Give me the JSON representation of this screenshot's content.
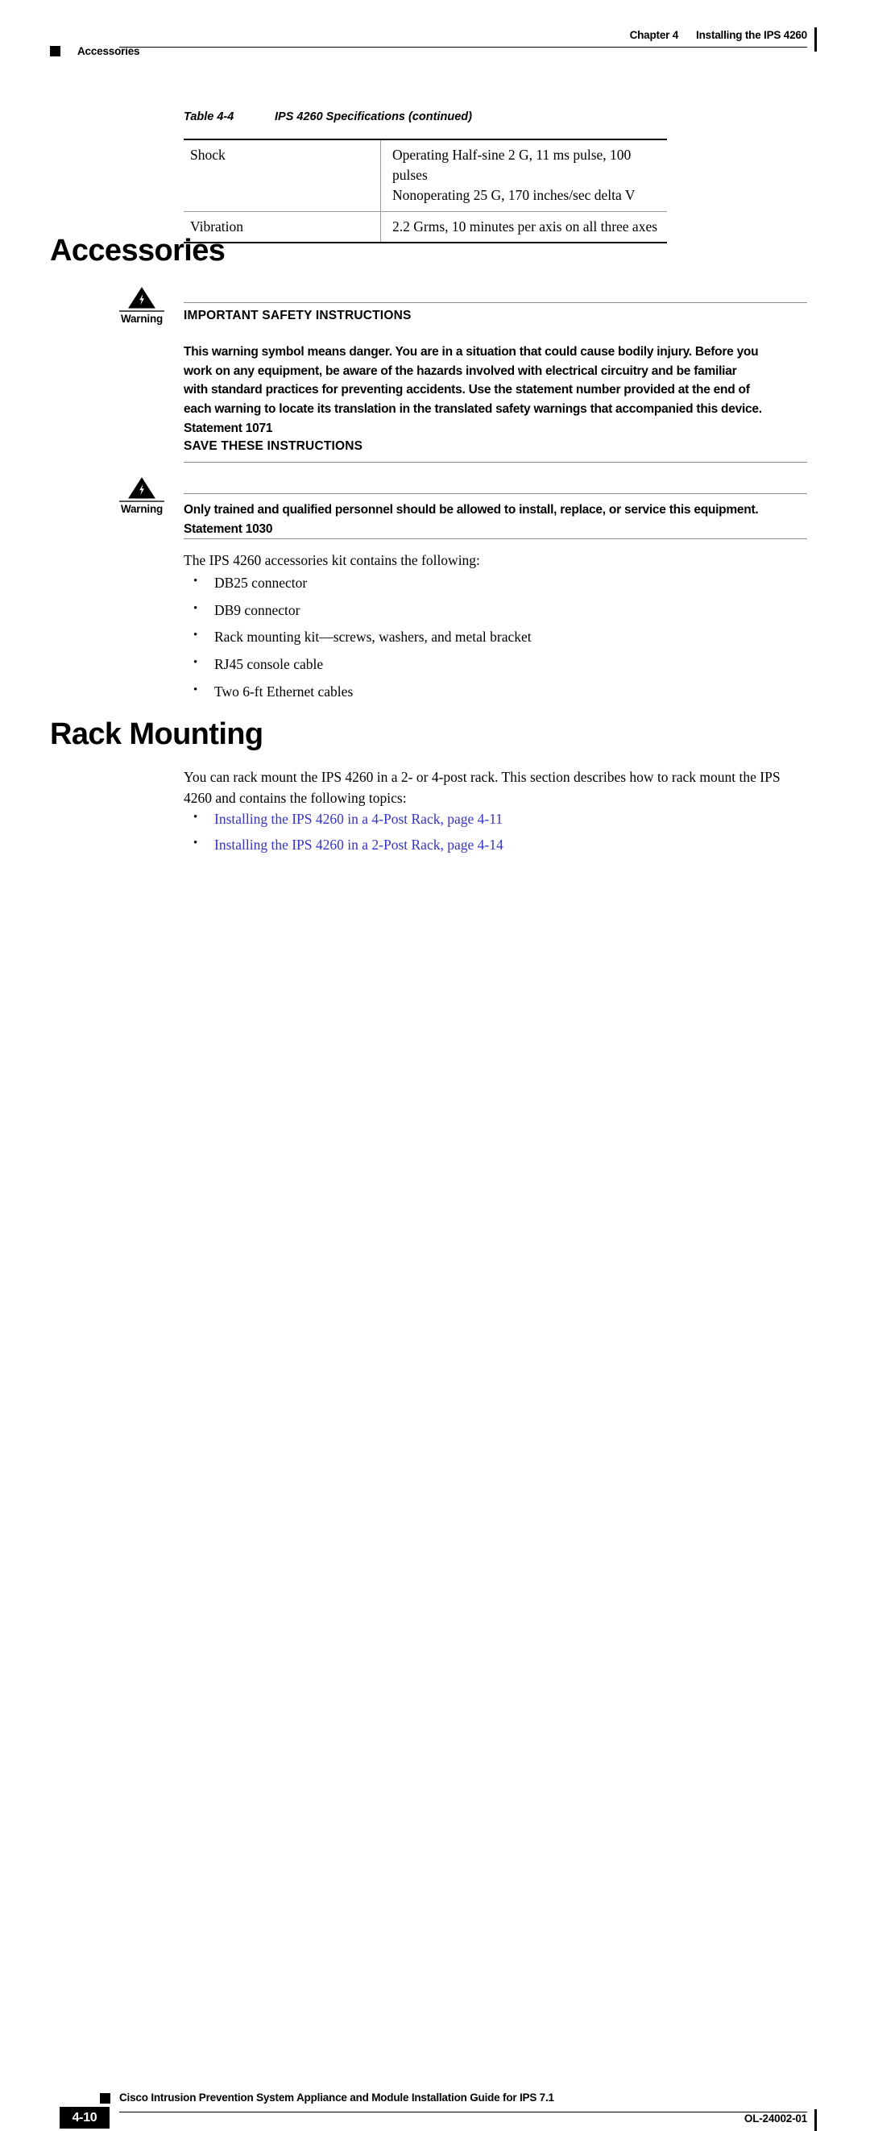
{
  "header": {
    "chapter_number": "Chapter 4",
    "chapter_title": "Installing the IPS 4260",
    "running_section": "Accessories"
  },
  "table": {
    "caption_number": "Table 4-4",
    "caption_title": "IPS 4260 Specifications (continued)",
    "rows": [
      {
        "key": "Shock",
        "values": [
          "Operating Half-sine 2 G, 11 ms pulse, 100 pulses",
          "Nonoperating 25 G, 170 inches/sec delta V"
        ]
      },
      {
        "key": "Vibration",
        "values": [
          "2.2 Grms, 10 minutes per axis on all three axes"
        ]
      }
    ]
  },
  "sections": {
    "accessories": {
      "title": "Accessories",
      "intro": "The IPS 4260 accessories kit contains the following:",
      "items": [
        "DB25 connector",
        "DB9 connector",
        "Rack mounting kit—screws, washers, and metal bracket",
        "RJ45 console cable",
        "Two 6-ft Ethernet cables"
      ]
    },
    "rack_mounting": {
      "title": "Rack Mounting",
      "intro": "You can rack mount the IPS 4260 in a 2- or 4-post rack. This section describes how to rack mount the IPS 4260 and contains the following topics:",
      "links": [
        "Installing the IPS 4260 in a 4-Post Rack, page 4-11",
        "Installing the IPS 4260 in a 2-Post Rack, page 4-14"
      ]
    }
  },
  "warnings": [
    {
      "label": "Warning",
      "heading": "IMPORTANT SAFETY INSTRUCTIONS",
      "body_lines": [
        "This warning symbol means danger. You are in a situation that could cause bodily injury. Before you",
        "work on any equipment, be aware of the hazards involved with electrical circuitry and be familiar",
        "with standard practices for preventing accidents. Use the statement number provided at the end of",
        "each warning to locate its translation in the translated safety warnings that accompanied this device.",
        "Statement 1071"
      ],
      "save_instructions": "SAVE THESE INSTRUCTIONS"
    },
    {
      "label": "Warning",
      "body_lines": [
        "Only trained and qualified personnel should be allowed to install, replace, or service this equipment.",
        "Statement 1030"
      ]
    }
  ],
  "footer": {
    "guide_title": "Cisco Intrusion Prevention System Appliance and Module Installation Guide for IPS 7.1",
    "page_number": "4-10",
    "document_id": "OL-24002-01"
  },
  "colors": {
    "link": "#3333cc",
    "rule": "#8c8c8c",
    "text": "#000000"
  }
}
